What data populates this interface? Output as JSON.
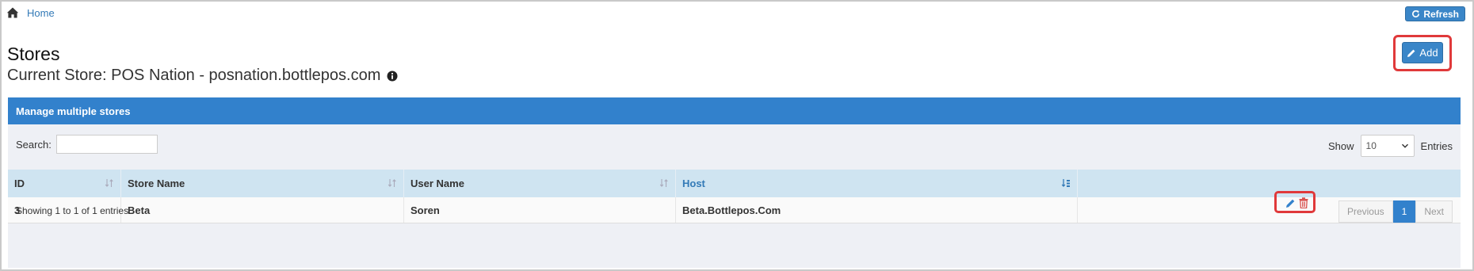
{
  "breadcrumb": {
    "home_label": "Home"
  },
  "toolbar": {
    "refresh_label": "Refresh",
    "add_label": "Add"
  },
  "page": {
    "title": "Stores",
    "current_store": "Current Store: POS Nation - posnation.bottlepos.com"
  },
  "panel": {
    "title": "Manage multiple stores",
    "search_label": "Search:",
    "search_value": "",
    "show_label": "Show",
    "show_value": "10",
    "entries_label": "Entries"
  },
  "table": {
    "columns": [
      "ID",
      "Store Name",
      "User Name",
      "Host"
    ],
    "sorted_column": "Host",
    "rows": [
      {
        "id": "3",
        "store_name": "Beta",
        "user_name": "Soren",
        "host": "Beta.Bottlepos.Com"
      }
    ]
  },
  "footer": {
    "info": "Showing 1 to 1 of 1 entries",
    "previous_label": "Previous",
    "current_page": "1",
    "next_label": "Next"
  },
  "colors": {
    "accent": "#3281cc",
    "header_row": "#cfe4f1",
    "highlight": "#e0393a",
    "delete": "#d9534f"
  },
  "icons": [
    "home-icon",
    "refresh-icon",
    "info-icon",
    "pencil-icon",
    "sort-icon",
    "sort-active-icon",
    "trash-icon",
    "chevron-down-icon"
  ]
}
